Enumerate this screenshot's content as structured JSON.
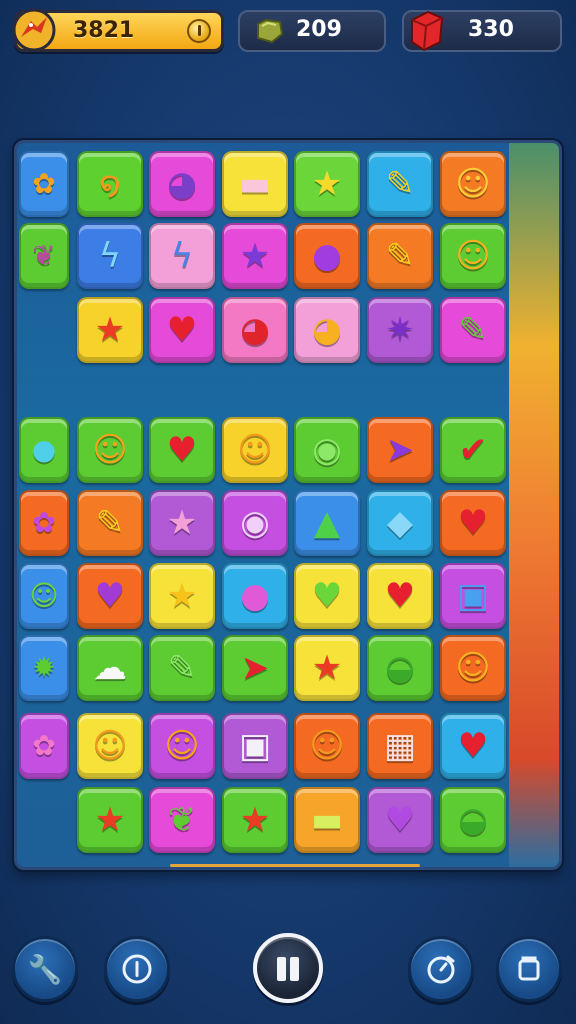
{
  "hud": {
    "score": "3821",
    "gems": "209",
    "lives": "330",
    "score_icon": "dragon-icon",
    "gems_icon": "green-gem-icon",
    "lives_icon": "red-box-icon",
    "accent": "#f3a712"
  },
  "board": {
    "tiles": [
      {
        "icon": "flower-icon",
        "glyph": "✿",
        "color": "#3b8fe8",
        "fg": "#f6a21b"
      },
      {
        "icon": "worm-icon",
        "glyph": "໑",
        "color": "#5ed131",
        "fg": "#f39a1c"
      },
      {
        "icon": "purple-monster-icon",
        "glyph": "◕",
        "color": "#e54ad8",
        "fg": "#7a3ec9"
      },
      {
        "icon": "pill-icon",
        "glyph": "▬",
        "color": "#f7e23a",
        "fg": "#f8c7d9"
      },
      {
        "icon": "star-icon",
        "glyph": "★",
        "color": "#6ad63a",
        "fg": "#f7d92a"
      },
      {
        "icon": "pencil-icon",
        "glyph": "✎",
        "color": "#2fb0e8",
        "fg": "#f7d020"
      },
      {
        "icon": "smiley-icon",
        "glyph": "☺",
        "color": "#f47a24",
        "fg": "#ffcc3a"
      },
      {
        "icon": "leaf-icon",
        "glyph": "❦",
        "color": "#5ccc32",
        "fg": "#b34d9c"
      },
      {
        "icon": "lightning-icon",
        "glyph": "ϟ",
        "color": "#3c7de6",
        "fg": "#7fd6ff"
      },
      {
        "icon": "lightning-icon",
        "glyph": "ϟ",
        "color": "#f3a0d8",
        "fg": "#4a83e6"
      },
      {
        "icon": "star-icon",
        "glyph": "★",
        "color": "#e54ad8",
        "fg": "#7b3bd6"
      },
      {
        "icon": "purple-blob-icon",
        "glyph": "●",
        "color": "#f46a22",
        "fg": "#a13de0"
      },
      {
        "icon": "pencil-icon",
        "glyph": "✎",
        "color": "#f47a24",
        "fg": "#f7d020"
      },
      {
        "icon": "sun-icon",
        "glyph": "☺",
        "color": "#5ccc32",
        "fg": "#f6b020"
      },
      {
        "icon": "star-icon",
        "glyph": "★",
        "color": "#f7d22a",
        "fg": "#ea3b24"
      },
      {
        "icon": "heart-icon",
        "glyph": "♥",
        "color": "#e54ad8",
        "fg": "#e6202f"
      },
      {
        "icon": "red-monster-icon",
        "glyph": "◕",
        "color": "#f479c4",
        "fg": "#e0242c"
      },
      {
        "icon": "orange-monster-icon",
        "glyph": "◕",
        "color": "#f3a0d8",
        "fg": "#f6b020"
      },
      {
        "icon": "purple-blob-icon",
        "glyph": "✷",
        "color": "#b25ad6",
        "fg": "#7a2fc8"
      },
      {
        "icon": "ticket-icon",
        "glyph": "✎",
        "color": "#e54ad8",
        "fg": "#5ccc32"
      },
      {
        "icon": "blue-drop-icon",
        "glyph": "●",
        "color": "#5ccc32",
        "fg": "#4fd0e8"
      },
      {
        "icon": "smiley-icon",
        "glyph": "☺",
        "color": "#5ccc32",
        "fg": "#f6a21b"
      },
      {
        "icon": "heart-icon",
        "glyph": "♥",
        "color": "#5ccc32",
        "fg": "#e6202f"
      },
      {
        "icon": "smiley-icon",
        "glyph": "☺",
        "color": "#f7d22a",
        "fg": "#f39a1c"
      },
      {
        "icon": "map-pin-icon",
        "glyph": "◉",
        "color": "#5ccc32",
        "fg": "#8de86a"
      },
      {
        "icon": "purple-bird-icon",
        "glyph": "➤",
        "color": "#f46a22",
        "fg": "#8a3ad6"
      },
      {
        "icon": "check-icon",
        "glyph": "✔",
        "color": "#5ccc32",
        "fg": "#e6202f"
      },
      {
        "icon": "flower-icon",
        "glyph": "✿",
        "color": "#f46a22",
        "fg": "#c04ae0"
      },
      {
        "icon": "pencil-icon",
        "glyph": "✎",
        "color": "#f47a24",
        "fg": "#f7d020"
      },
      {
        "icon": "star-icon",
        "glyph": "★",
        "color": "#b25ad6",
        "fg": "#f3a0d8"
      },
      {
        "icon": "lollipop-icon",
        "glyph": "◉",
        "color": "#c54fe0",
        "fg": "#f0d0f8"
      },
      {
        "icon": "green-drop-icon",
        "glyph": "▲",
        "color": "#3b8fe8",
        "fg": "#4fd04a"
      },
      {
        "icon": "blue-gem-icon",
        "glyph": "◆",
        "color": "#2fb0e8",
        "fg": "#8ad8f8"
      },
      {
        "icon": "heart-icon",
        "glyph": "♥",
        "color": "#f46a22",
        "fg": "#e6202f"
      },
      {
        "icon": "green-monster-icon",
        "glyph": "☺",
        "color": "#3b8fe8",
        "fg": "#6ad63a"
      },
      {
        "icon": "purple-heart-icon",
        "glyph": "♥",
        "color": "#f46a22",
        "fg": "#a23ad6"
      },
      {
        "icon": "star-icon",
        "glyph": "★",
        "color": "#f7e23a",
        "fg": "#f7c21a"
      },
      {
        "icon": "pink-balloon-icon",
        "glyph": "●",
        "color": "#2fb0e8",
        "fg": "#e05ad8"
      },
      {
        "icon": "green-heart-icon",
        "glyph": "♥",
        "color": "#f7e23a",
        "fg": "#6ad63a"
      },
      {
        "icon": "heart-icon",
        "glyph": "♥",
        "color": "#f7e23a",
        "fg": "#e6202f"
      },
      {
        "icon": "blue-cube-icon",
        "glyph": "▣",
        "color": "#c54fe0",
        "fg": "#4aa0f0"
      },
      {
        "icon": "cactus-icon",
        "glyph": "✹",
        "color": "#3b8fe8",
        "fg": "#5ccc32"
      },
      {
        "icon": "cloud-icon",
        "glyph": "☁",
        "color": "#5ccc32",
        "fg": "#f8f8f8"
      },
      {
        "icon": "ticket-icon",
        "glyph": "✎",
        "color": "#5ccc32",
        "fg": "#8de86a"
      },
      {
        "icon": "red-bird-icon",
        "glyph": "➤",
        "color": "#5ccc32",
        "fg": "#e6202f"
      },
      {
        "icon": "star-icon",
        "glyph": "★",
        "color": "#f7e23a",
        "fg": "#ea3b24"
      },
      {
        "icon": "green-mound-icon",
        "glyph": "◒",
        "color": "#5ccc32",
        "fg": "#3aaa2a"
      },
      {
        "icon": "smiley-icon",
        "glyph": "☺",
        "color": "#f46a22",
        "fg": "#f6b020"
      },
      {
        "icon": "flower-icon",
        "glyph": "✿",
        "color": "#c54fe0",
        "fg": "#f478c8"
      },
      {
        "icon": "smiley-icon",
        "glyph": "☺",
        "color": "#f7e23a",
        "fg": "#f39a1c"
      },
      {
        "icon": "smiley-icon",
        "glyph": "☺",
        "color": "#c54fe0",
        "fg": "#f6a21b"
      },
      {
        "icon": "purple-cube-icon",
        "glyph": "▣",
        "color": "#b25ad6",
        "fg": "#f4f0f8"
      },
      {
        "icon": "orange-face-icon",
        "glyph": "☺",
        "color": "#f46a22",
        "fg": "#f39a1c"
      },
      {
        "icon": "chocolate-bar-icon",
        "glyph": "▦",
        "color": "#f46a22",
        "fg": "#f8e0e0"
      },
      {
        "icon": "heart-icon",
        "glyph": "♥",
        "color": "#2fb0e8",
        "fg": "#e6202f"
      },
      {
        "icon": "star-icon",
        "glyph": "★",
        "color": "#5ccc32",
        "fg": "#ea3b24"
      },
      {
        "icon": "leaf-icon",
        "glyph": "❦",
        "color": "#e54ad8",
        "fg": "#5ccc32"
      },
      {
        "icon": "star-icon",
        "glyph": "★",
        "color": "#5ccc32",
        "fg": "#ea3b24"
      },
      {
        "icon": "pill-icon",
        "glyph": "▬",
        "color": "#f7a52a",
        "fg": "#d8f060"
      },
      {
        "icon": "heart-icon",
        "glyph": "♥",
        "color": "#b25ad6",
        "fg": "#b04ae0"
      },
      {
        "icon": "green-mound-icon",
        "glyph": "◒",
        "color": "#5ccc32",
        "fg": "#3aaa2a"
      }
    ]
  },
  "controls": {
    "left_icon": "wrench-icon",
    "info_icon": "info-icon",
    "pause_icon": "pause-icon",
    "timer_icon": "timer-icon",
    "menu_icon": "square-menu-icon"
  }
}
